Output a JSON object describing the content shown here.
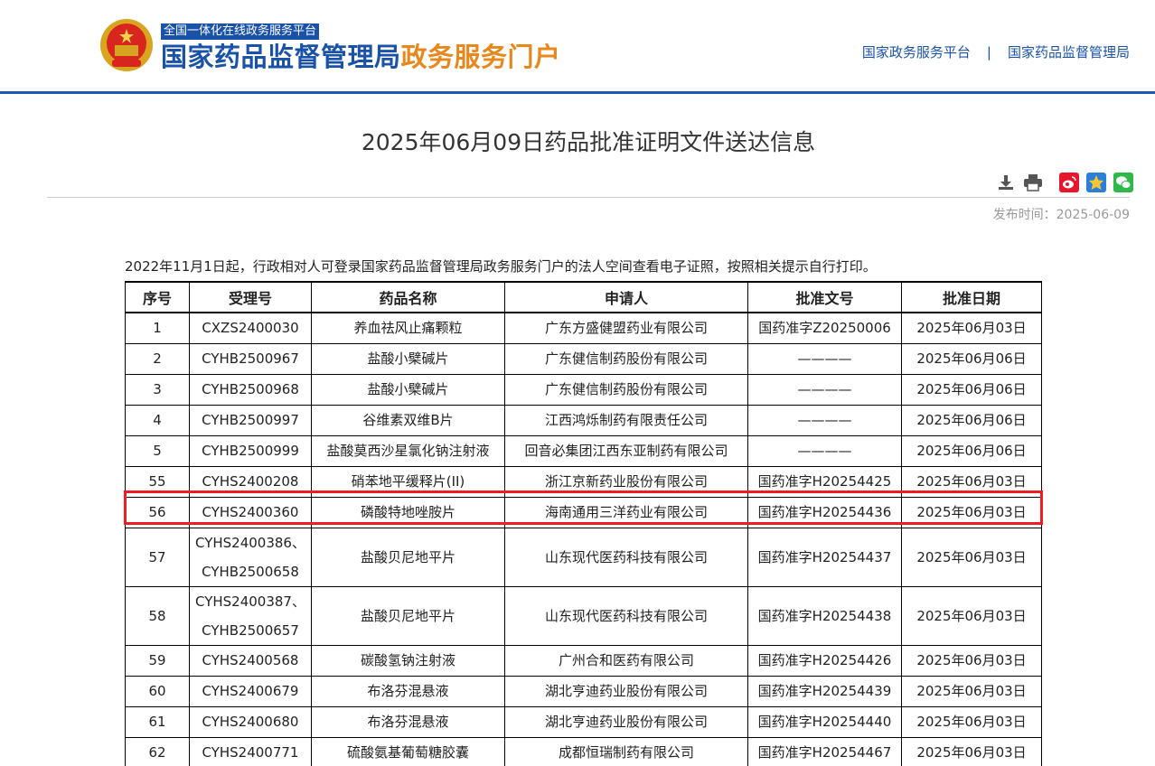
{
  "header": {
    "platform_tag": "全国一体化在线政务服务平台",
    "title_main": "国家药品监督管理局",
    "title_sub": "政务服务门户",
    "links": [
      "国家政务服务平台",
      "国家药品监督管理局"
    ],
    "separator": "|"
  },
  "article": {
    "title": "2025年06月09日药品批准证明文件送达信息",
    "publish_label": "发布时间：",
    "publish_date": "2025-06-09",
    "notice": "2022年11月1日起，行政相对人可登录国家药品监督管理局政务服务门户的法人空间查看电子证照，按照相关提示自行打印。"
  },
  "tools": [
    "download-icon",
    "print-icon",
    "weibo-icon",
    "qzone-icon",
    "wechat-icon"
  ],
  "colors": {
    "brand_blue": "#1a52a8",
    "brand_orange": "#e8871c",
    "highlight_red": "#ee1c25"
  },
  "table": {
    "headers": [
      "序号",
      "受理号",
      "药品名称",
      "申请人",
      "批准文号",
      "批准日期"
    ],
    "rows": [
      {
        "no": "1",
        "acc": "CXZS2400030",
        "acc2": "",
        "name": "养血祛风止痛颗粒",
        "applicant": "广东方盛健盟药业有限公司",
        "approval": "国药准字Z20250006",
        "date": "2025年06月03日"
      },
      {
        "no": "2",
        "acc": "CYHB2500967",
        "acc2": "",
        "name": "盐酸小檗碱片",
        "applicant": "广东健信制药股份有限公司",
        "approval": "————",
        "date": "2025年06月06日"
      },
      {
        "no": "3",
        "acc": "CYHB2500968",
        "acc2": "",
        "name": "盐酸小檗碱片",
        "applicant": "广东健信制药股份有限公司",
        "approval": "————",
        "date": "2025年06月06日"
      },
      {
        "no": "4",
        "acc": "CYHB2500997",
        "acc2": "",
        "name": "谷维素双维B片",
        "applicant": "江西鸿烁制药有限责任公司",
        "approval": "————",
        "date": "2025年06月06日"
      },
      {
        "no": "5",
        "acc": "CYHB2500999",
        "acc2": "",
        "name": "盐酸莫西沙星氯化钠注射液",
        "applicant": "回音必集团江西东亚制药有限公司",
        "approval": "————",
        "date": "2025年06月06日"
      },
      {
        "no": "55",
        "acc": "CYHS2400208",
        "acc2": "",
        "name": "硝苯地平缓释片(II)",
        "applicant": "浙江京新药业股份有限公司",
        "approval": "国药准字H20254425",
        "date": "2025年06月03日"
      },
      {
        "no": "56",
        "acc": "CYHS2400360",
        "acc2": "",
        "name": "磷酸特地唑胺片",
        "applicant": "海南通用三洋药业有限公司",
        "approval": "国药准字H20254436",
        "date": "2025年06月03日"
      },
      {
        "no": "57",
        "acc": "CYHS2400386、",
        "acc2": "CYHB2500658",
        "name": "盐酸贝尼地平片",
        "applicant": "山东现代医药科技有限公司",
        "approval": "国药准字H20254437",
        "date": "2025年06月03日"
      },
      {
        "no": "58",
        "acc": "CYHS2400387、",
        "acc2": "CYHB2500657",
        "name": "盐酸贝尼地平片",
        "applicant": "山东现代医药科技有限公司",
        "approval": "国药准字H20254438",
        "date": "2025年06月03日"
      },
      {
        "no": "59",
        "acc": "CYHS2400568",
        "acc2": "",
        "name": "碳酸氢钠注射液",
        "applicant": "广州合和医药有限公司",
        "approval": "国药准字H20254426",
        "date": "2025年06月03日"
      },
      {
        "no": "60",
        "acc": "CYHS2400679",
        "acc2": "",
        "name": "布洛芬混悬液",
        "applicant": "湖北亨迪药业股份有限公司",
        "approval": "国药准字H20254439",
        "date": "2025年06月03日"
      },
      {
        "no": "61",
        "acc": "CYHS2400680",
        "acc2": "",
        "name": "布洛芬混悬液",
        "applicant": "湖北亨迪药业股份有限公司",
        "approval": "国药准字H20254440",
        "date": "2025年06月03日"
      },
      {
        "no": "62",
        "acc": "CYHS2400771",
        "acc2": "",
        "name": "硫酸氨基葡萄糖胶囊",
        "applicant": "成都恒瑞制药有限公司",
        "approval": "国药准字H20254467",
        "date": "2025年06月03日"
      }
    ]
  }
}
